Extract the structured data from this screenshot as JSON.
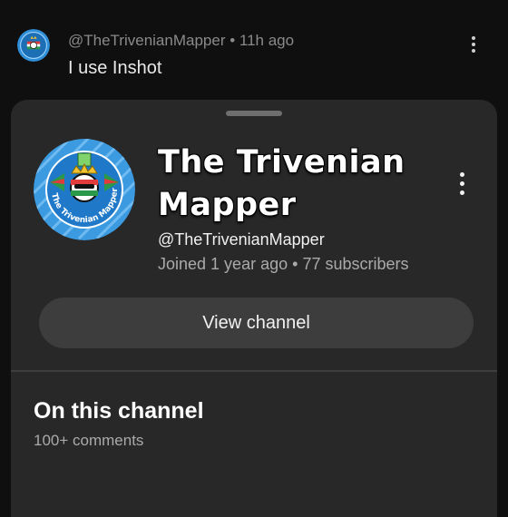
{
  "comment": {
    "author": "@TheTrivenianMapper",
    "separator": "•",
    "time": "11h ago",
    "text": "I use Inshot",
    "avatar_icon": "channel-logo-icon",
    "more_icon": "more-vertical-icon"
  },
  "channel": {
    "name": "The Trivenian Mapper",
    "handle": "@TheTrivenianMapper",
    "joined": "Joined 1 year ago",
    "separator": "•",
    "subscribers": "77 subscribers",
    "avatar_icon": "channel-logo-icon",
    "avatar_ring_text": "The Trivenian Mapper",
    "more_icon": "more-vertical-icon",
    "view_button_label": "View channel"
  },
  "section": {
    "title": "On this channel",
    "subtitle": "100+ comments"
  },
  "colors": {
    "background": "#0f0f0f",
    "sheet": "#282828",
    "button": "#3d3d3d",
    "logo_blue": "#2f8fd8"
  }
}
